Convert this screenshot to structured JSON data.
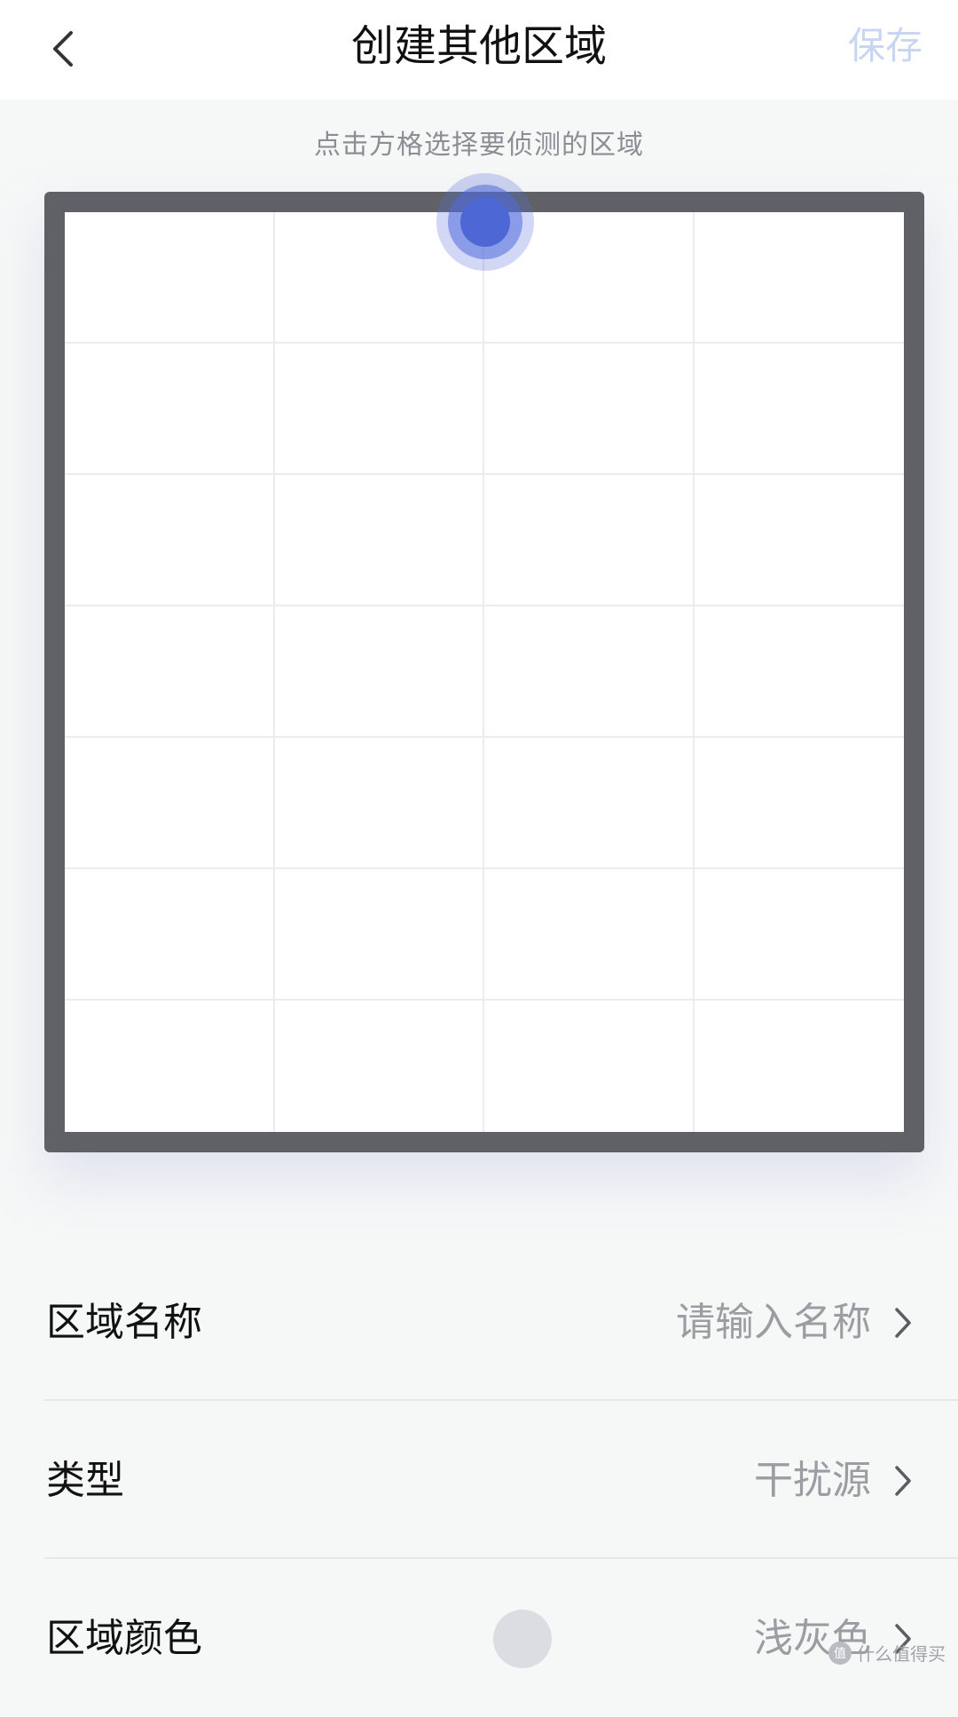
{
  "header": {
    "title": "创建其他区域",
    "save_label": "保存",
    "back_icon": "chevron-left-icon"
  },
  "hint": "点击方格选择要侦测的区域",
  "grid": {
    "columns": 4,
    "rows": 7
  },
  "form": {
    "name": {
      "label": "区域名称",
      "placeholder": "请输入名称"
    },
    "type": {
      "label": "类型",
      "value": "干扰源"
    },
    "color": {
      "label": "区域颜色",
      "value": "浅灰色",
      "swatch": "#dcdde3"
    }
  },
  "watermark": {
    "text": "什么值得买",
    "logo": "值"
  },
  "colors": {
    "accent": "#4d67d4",
    "save_disabled": "#c8d6f2",
    "frame": "#5f6166"
  }
}
